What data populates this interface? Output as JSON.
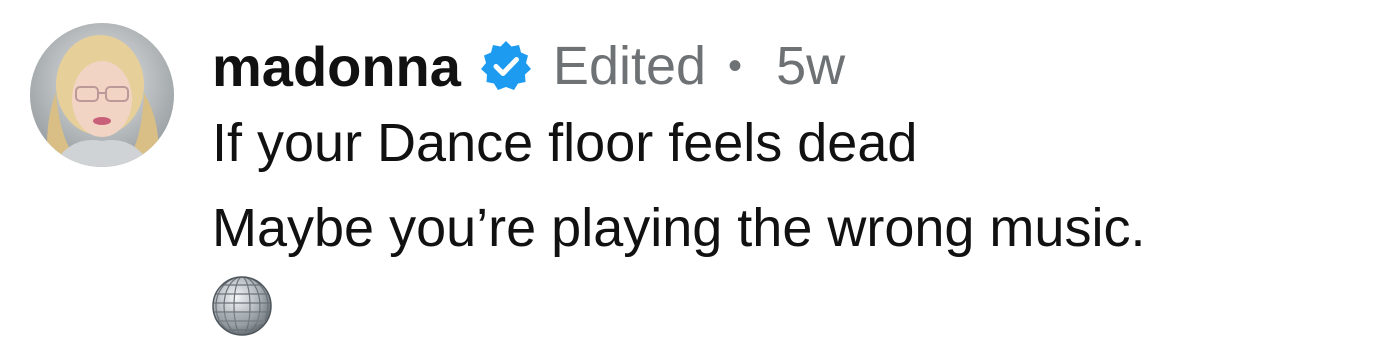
{
  "comment": {
    "username": "madonna",
    "verified": true,
    "edited_label": "Edited",
    "separator": "•",
    "timestamp": "5w",
    "lines": [
      "If your Dance floor feels dead",
      "Maybe you’re playing the wrong music."
    ],
    "emoji": "disco-ball-emoji"
  },
  "colors": {
    "verified_badge": "#1d9bf0",
    "text": "#111111",
    "meta_text": "#6f7274"
  }
}
